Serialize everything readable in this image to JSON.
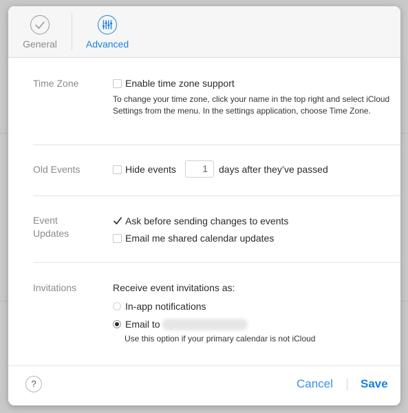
{
  "tabs": {
    "general": {
      "label": "General",
      "icon": "checkmark-circle-icon"
    },
    "advanced": {
      "label": "Advanced",
      "icon": "sliders-icon"
    }
  },
  "time_zone": {
    "label": "Time Zone",
    "checkbox_label": "Enable time zone support",
    "checked": false,
    "help_text": "To change your time zone, click your name in the top right and select iCloud Settings from the menu. In the settings application, choose Time Zone."
  },
  "old_events": {
    "label": "Old Events",
    "prefix": "Hide events",
    "days_value": "1",
    "suffix": "days after they’ve passed",
    "checked": false
  },
  "event_updates": {
    "label_line1": "Event",
    "label_line2": "Updates",
    "options": [
      {
        "label": "Ask before sending changes to events",
        "checked": true
      },
      {
        "label": "Email me shared calendar updates",
        "checked": false
      }
    ]
  },
  "invitations": {
    "label": "Invitations",
    "prompt": "Receive event invitations as:",
    "options": [
      {
        "label": "In-app notifications",
        "selected": false
      },
      {
        "label": "Email to",
        "selected": true
      }
    ],
    "email_help": "Use this option if your primary calendar is not iCloud"
  },
  "footer": {
    "help_label": "?",
    "cancel_label": "Cancel",
    "save_label": "Save"
  },
  "colors": {
    "accent": "#1a82e0",
    "muted_label": "#8a8a8a"
  }
}
